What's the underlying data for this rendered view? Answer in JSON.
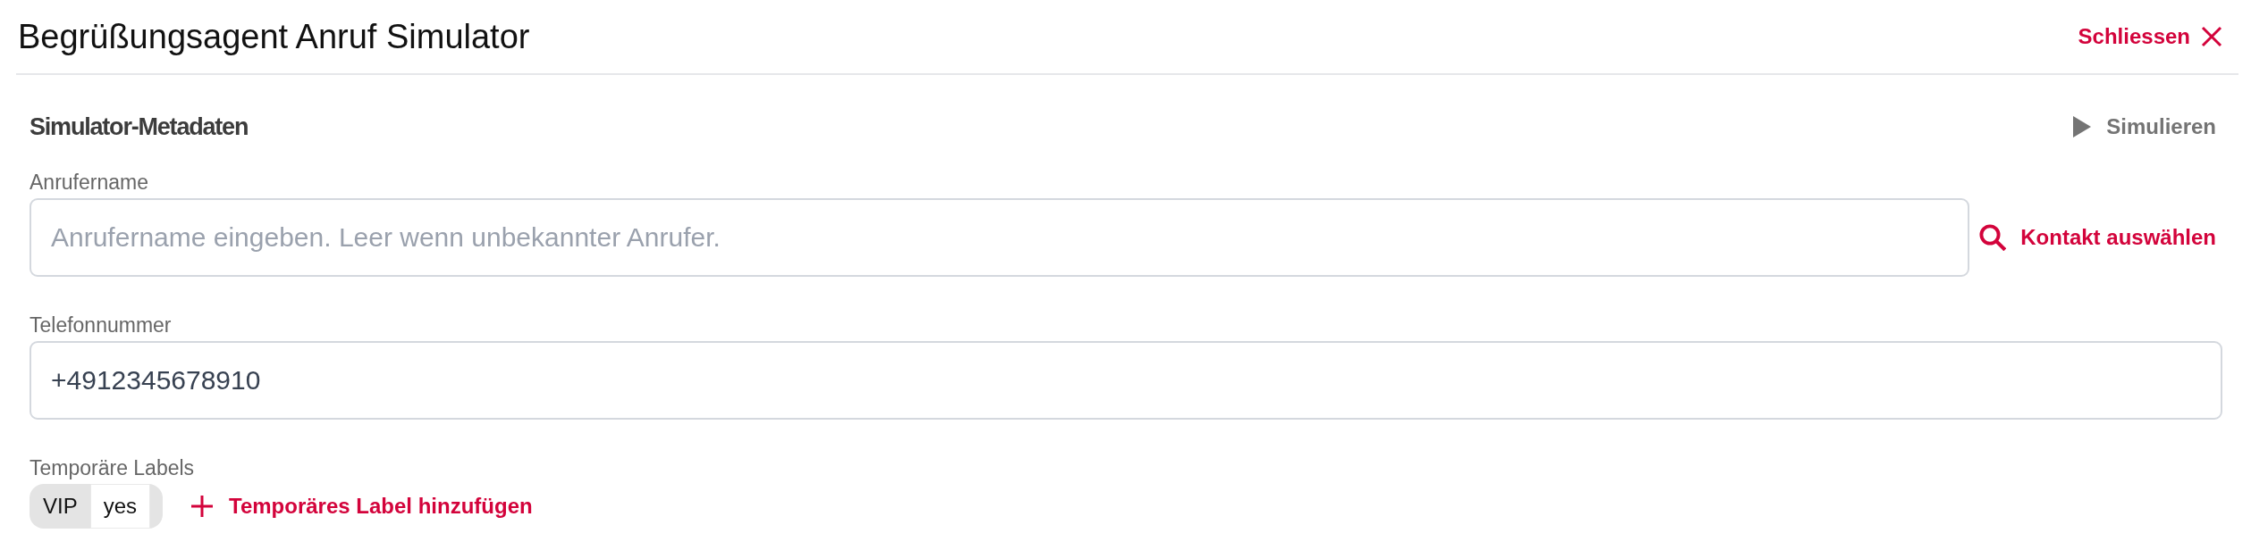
{
  "window": {
    "title": "Begrüßungsagent Anruf Simulator",
    "close_label": "Schliessen"
  },
  "section": {
    "title": "Simulator-Metadaten",
    "action": "Simulieren"
  },
  "fields": [
    {
      "kind": "text",
      "label": "Anrufername",
      "placeholder": "Anrufername eingeben. Leer wenn unbekannter Anrufer.",
      "action": "Kontakt auswählen"
    },
    {
      "kind": "text",
      "label": "Telefonnummer",
      "value": "+4912345678910"
    }
  ],
  "temporary_labels": {
    "label": "Temporäre Labels",
    "items": [
      {
        "key": "VIP",
        "value": "yes"
      }
    ],
    "add_label": "Temporäres Label hinzufügen"
  }
}
